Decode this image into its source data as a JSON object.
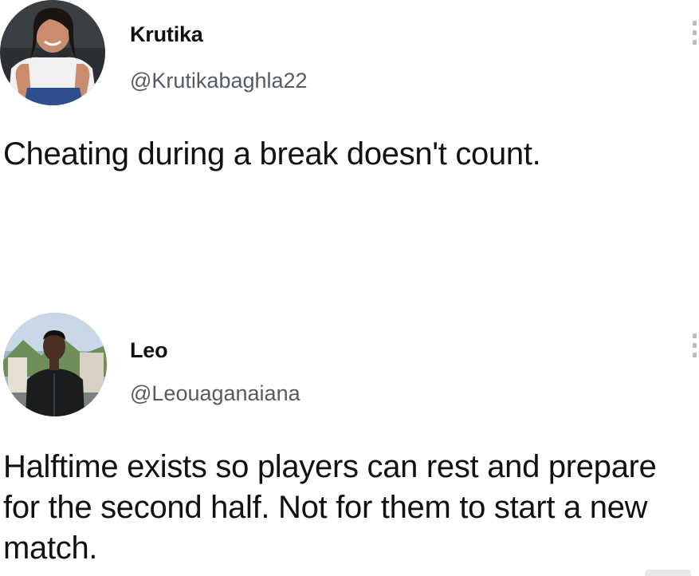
{
  "tweets": [
    {
      "display_name": "Krutika",
      "handle": "@Krutikabaghla22",
      "text": "Cheating during a break doesn't count.",
      "avatar_icon": "profile-photo-woman",
      "menu_icon": "more-vertical-icon"
    },
    {
      "display_name": "Leo",
      "handle": "@Leouaganaiana",
      "text": "Halftime exists so players can rest and prepare for the second half. Not for them to start a new match.",
      "avatar_icon": "profile-photo-man",
      "menu_icon": "more-vertical-icon"
    }
  ],
  "colors": {
    "background": "#ffffff",
    "text": "#111111",
    "handle": "#555b61",
    "menu_dots": "#b9bdc1"
  }
}
